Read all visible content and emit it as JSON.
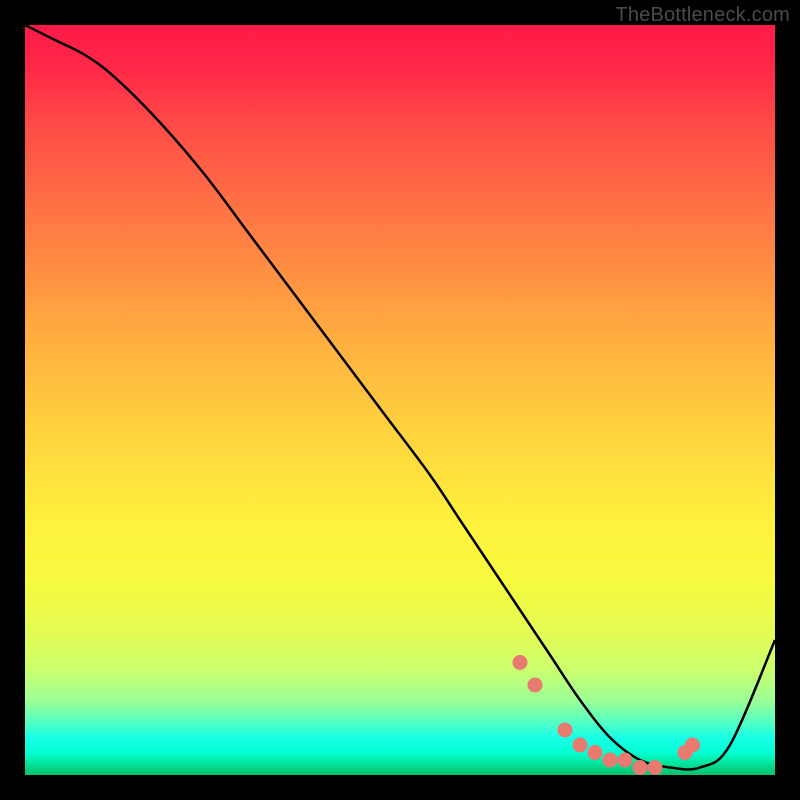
{
  "watermark": "TheBottleneck.com",
  "chart_data": {
    "type": "line",
    "title": "",
    "xlabel": "",
    "ylabel": "",
    "xlim": [
      0,
      100
    ],
    "ylim": [
      0,
      100
    ],
    "series": [
      {
        "name": "bottleneck-curve",
        "x": [
          0,
          4,
          8,
          12,
          18,
          24,
          30,
          36,
          42,
          48,
          54,
          58,
          62,
          66,
          70,
          74,
          78,
          82,
          86,
          90,
          94,
          100
        ],
        "values": [
          100,
          98,
          96,
          93,
          87,
          80,
          72,
          64,
          56,
          48,
          40,
          34,
          28,
          22,
          16,
          10,
          5,
          2,
          1,
          1,
          4,
          18
        ]
      }
    ],
    "markers": {
      "name": "highlight-dots",
      "color": "#e87a6f",
      "x": [
        66,
        68,
        72,
        74,
        76,
        78,
        80,
        82,
        84,
        88,
        89
      ],
      "values": [
        15,
        12,
        6,
        4,
        3,
        2,
        2,
        1,
        1,
        3,
        4
      ]
    },
    "background_gradient": {
      "orientation": "vertical",
      "stops": [
        {
          "pos": 0,
          "color": "#ff1947"
        },
        {
          "pos": 0.5,
          "color": "#ffd23e"
        },
        {
          "pos": 0.8,
          "color": "#e3fb53"
        },
        {
          "pos": 0.95,
          "color": "#18ffe7"
        },
        {
          "pos": 1.0,
          "color": "#08c06d"
        }
      ]
    }
  }
}
